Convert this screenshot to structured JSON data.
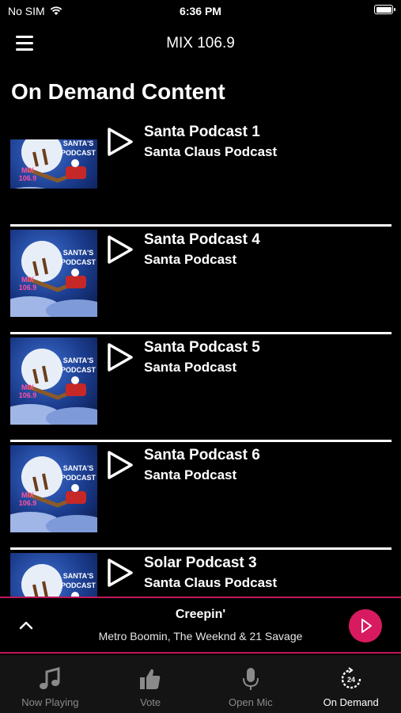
{
  "status": {
    "carrier": "No SIM",
    "time": "6:36 PM"
  },
  "header": {
    "title": "MIX 106.9"
  },
  "page": {
    "title": "On Demand Content"
  },
  "items": [
    {
      "title": "Santa Podcast 1",
      "subtitle": "Santa Claus Podcast"
    },
    {
      "title": "Santa Podcast 4",
      "subtitle": "Santa Podcast"
    },
    {
      "title": "Santa Podcast 5",
      "subtitle": "Santa Podcast"
    },
    {
      "title": "Santa Podcast 6",
      "subtitle": "Santa Podcast"
    },
    {
      "title": "Solar Podcast 3",
      "subtitle": "Santa Claus Podcast"
    }
  ],
  "thumb": {
    "line1": "SANTA'S",
    "line2": "PODCAST",
    "logo_top": "MIX",
    "logo_bottom": "106.9"
  },
  "now_playing": {
    "song": "Creepin'",
    "artist": "Metro Boomin, The Weeknd & 21 Savage"
  },
  "tabs": [
    {
      "label": "Now Playing",
      "icon": "music-note-icon"
    },
    {
      "label": "Vote",
      "icon": "thumbs-up-icon"
    },
    {
      "label": "Open Mic",
      "icon": "microphone-icon"
    },
    {
      "label": "On Demand",
      "icon": "clock-24-icon"
    }
  ],
  "colors": {
    "accent": "#d81b60",
    "tab_inactive": "#8a8a8a",
    "tab_bar_bg": "#141414"
  }
}
